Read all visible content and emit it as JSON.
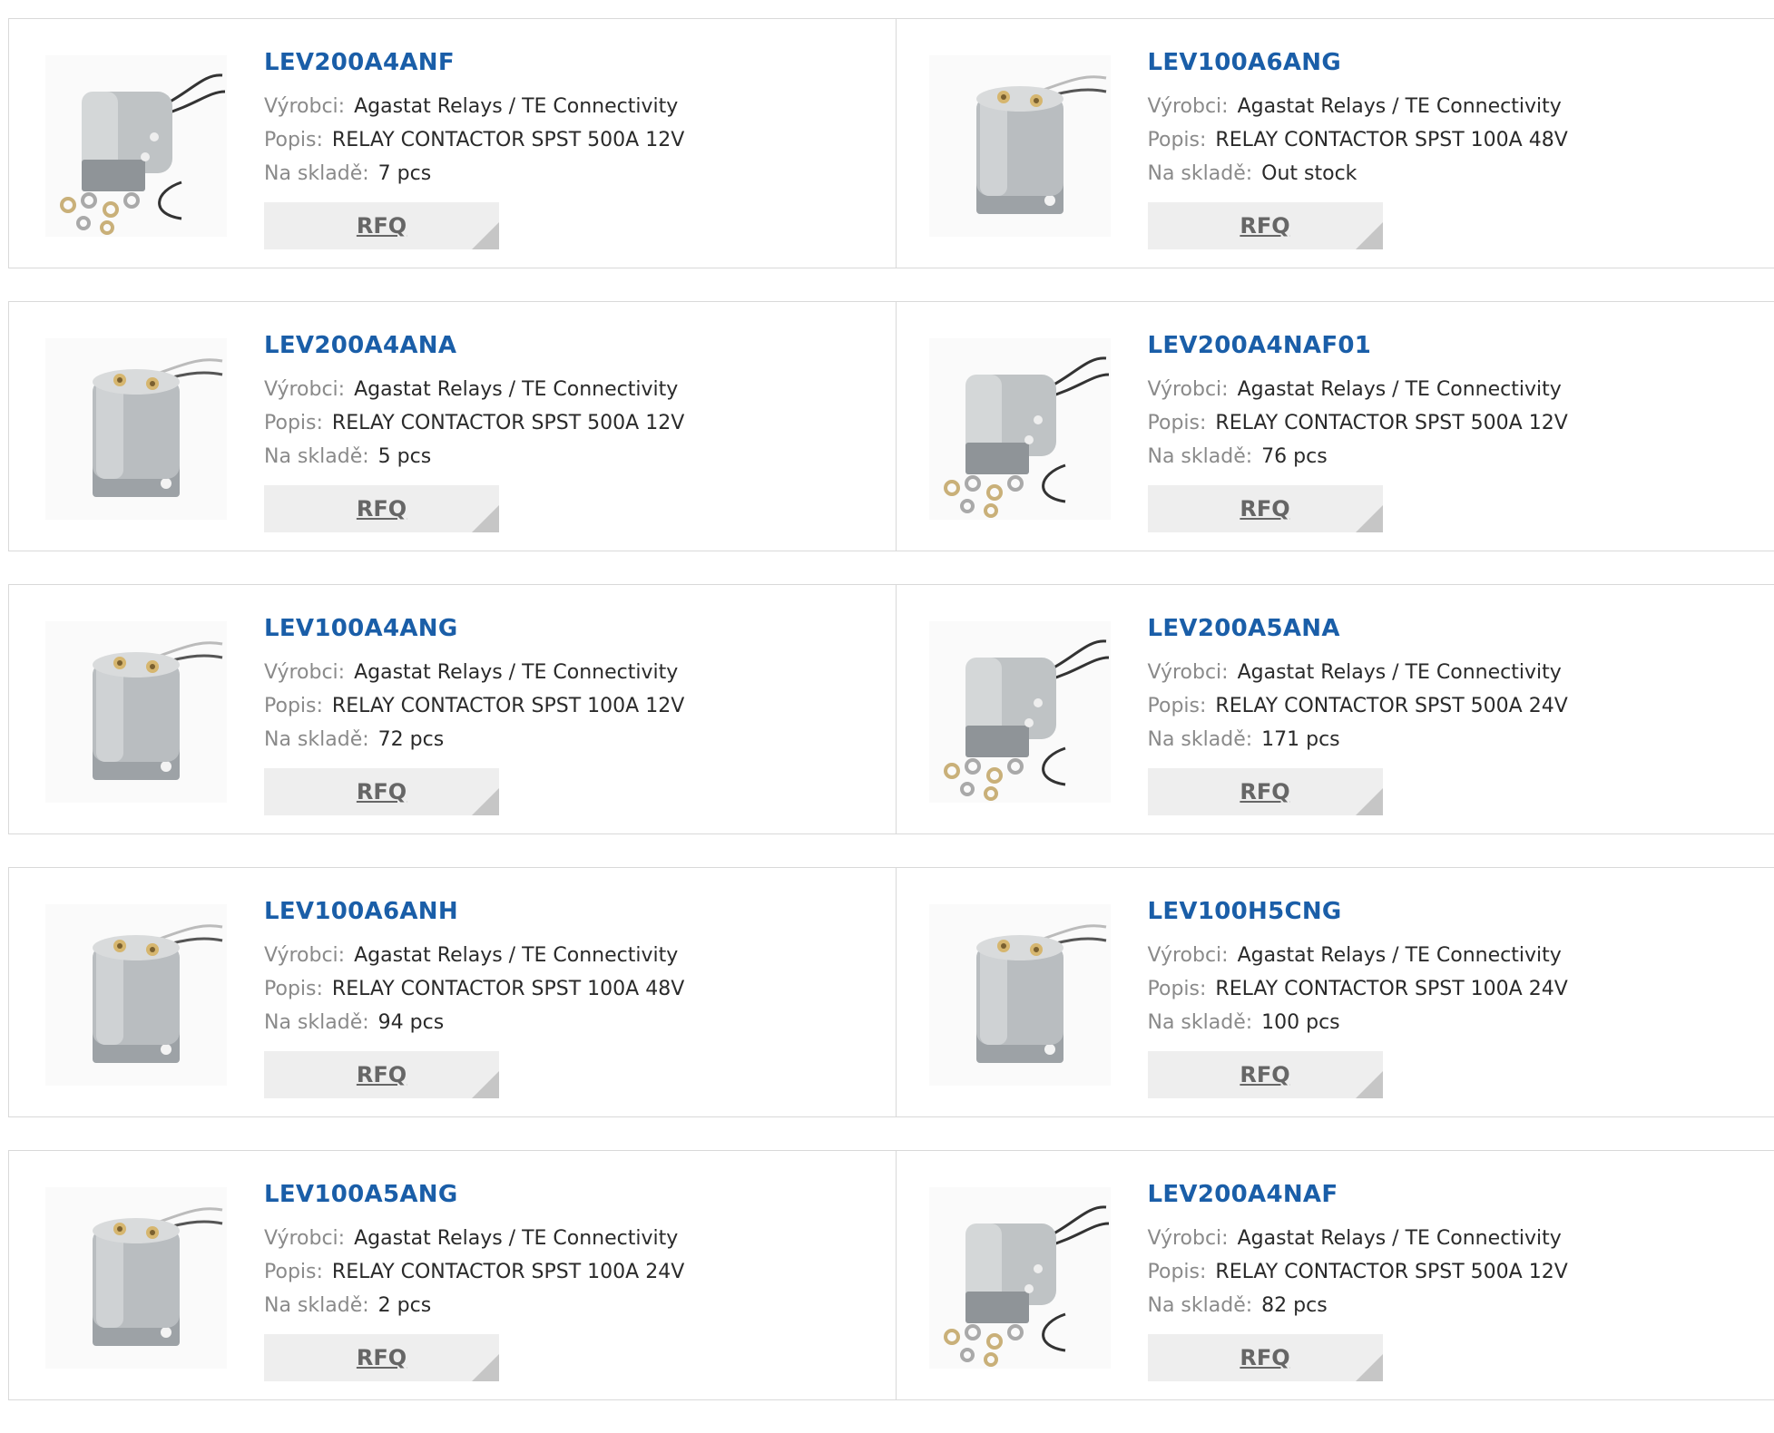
{
  "labels": {
    "manufacturer": "Výrobci:",
    "description": "Popis:",
    "stock": "Na skladě:",
    "rfq": "RFQ"
  },
  "products": [
    {
      "part": "LEV200A4ANF",
      "manufacturer": "Agastat Relays / TE Connectivity",
      "description": "RELAY CONTACTOR SPST 500A 12V",
      "stock": "7 pcs",
      "image_icon": "relay-contactor-with-hardware-icon"
    },
    {
      "part": "LEV100A6ANG",
      "manufacturer": "Agastat Relays / TE Connectivity",
      "description": "RELAY CONTACTOR SPST 100A 48V",
      "stock": "Out stock",
      "image_icon": "relay-contactor-icon"
    },
    {
      "part": "LEV200A4ANA",
      "manufacturer": "Agastat Relays / TE Connectivity",
      "description": "RELAY CONTACTOR SPST 500A 12V",
      "stock": "5 pcs",
      "image_icon": "relay-contactor-icon"
    },
    {
      "part": "LEV200A4NAF01",
      "manufacturer": "Agastat Relays / TE Connectivity",
      "description": "RELAY CONTACTOR SPST 500A 12V",
      "stock": "76 pcs",
      "image_icon": "relay-contactor-with-hardware-icon"
    },
    {
      "part": "LEV100A4ANG",
      "manufacturer": "Agastat Relays / TE Connectivity",
      "description": "RELAY CONTACTOR SPST 100A 12V",
      "stock": "72 pcs",
      "image_icon": "relay-contactor-icon"
    },
    {
      "part": "LEV200A5ANA",
      "manufacturer": "Agastat Relays / TE Connectivity",
      "description": "RELAY CONTACTOR SPST 500A 24V",
      "stock": "171 pcs",
      "image_icon": "relay-contactor-with-hardware-icon"
    },
    {
      "part": "LEV100A6ANH",
      "manufacturer": "Agastat Relays / TE Connectivity",
      "description": "RELAY CONTACTOR SPST 100A 48V",
      "stock": "94 pcs",
      "image_icon": "relay-contactor-icon"
    },
    {
      "part": "LEV100H5CNG",
      "manufacturer": "Agastat Relays / TE Connectivity",
      "description": "RELAY CONTACTOR SPST 100A 24V",
      "stock": "100 pcs",
      "image_icon": "relay-contactor-icon"
    },
    {
      "part": "LEV100A5ANG",
      "manufacturer": "Agastat Relays / TE Connectivity",
      "description": "RELAY CONTACTOR SPST 100A 24V",
      "stock": "2 pcs",
      "image_icon": "relay-contactor-icon"
    },
    {
      "part": "LEV200A4NAF",
      "manufacturer": "Agastat Relays / TE Connectivity",
      "description": "RELAY CONTACTOR SPST 500A 12V",
      "stock": "82 pcs",
      "image_icon": "relay-contactor-with-hardware-icon"
    }
  ],
  "colors": {
    "title": "#1a5ea8",
    "label": "#8a8a8a",
    "value": "#2a2a2a",
    "button_bg": "#eeeeee",
    "button_text": "#666666",
    "border": "#d9d9d9"
  }
}
